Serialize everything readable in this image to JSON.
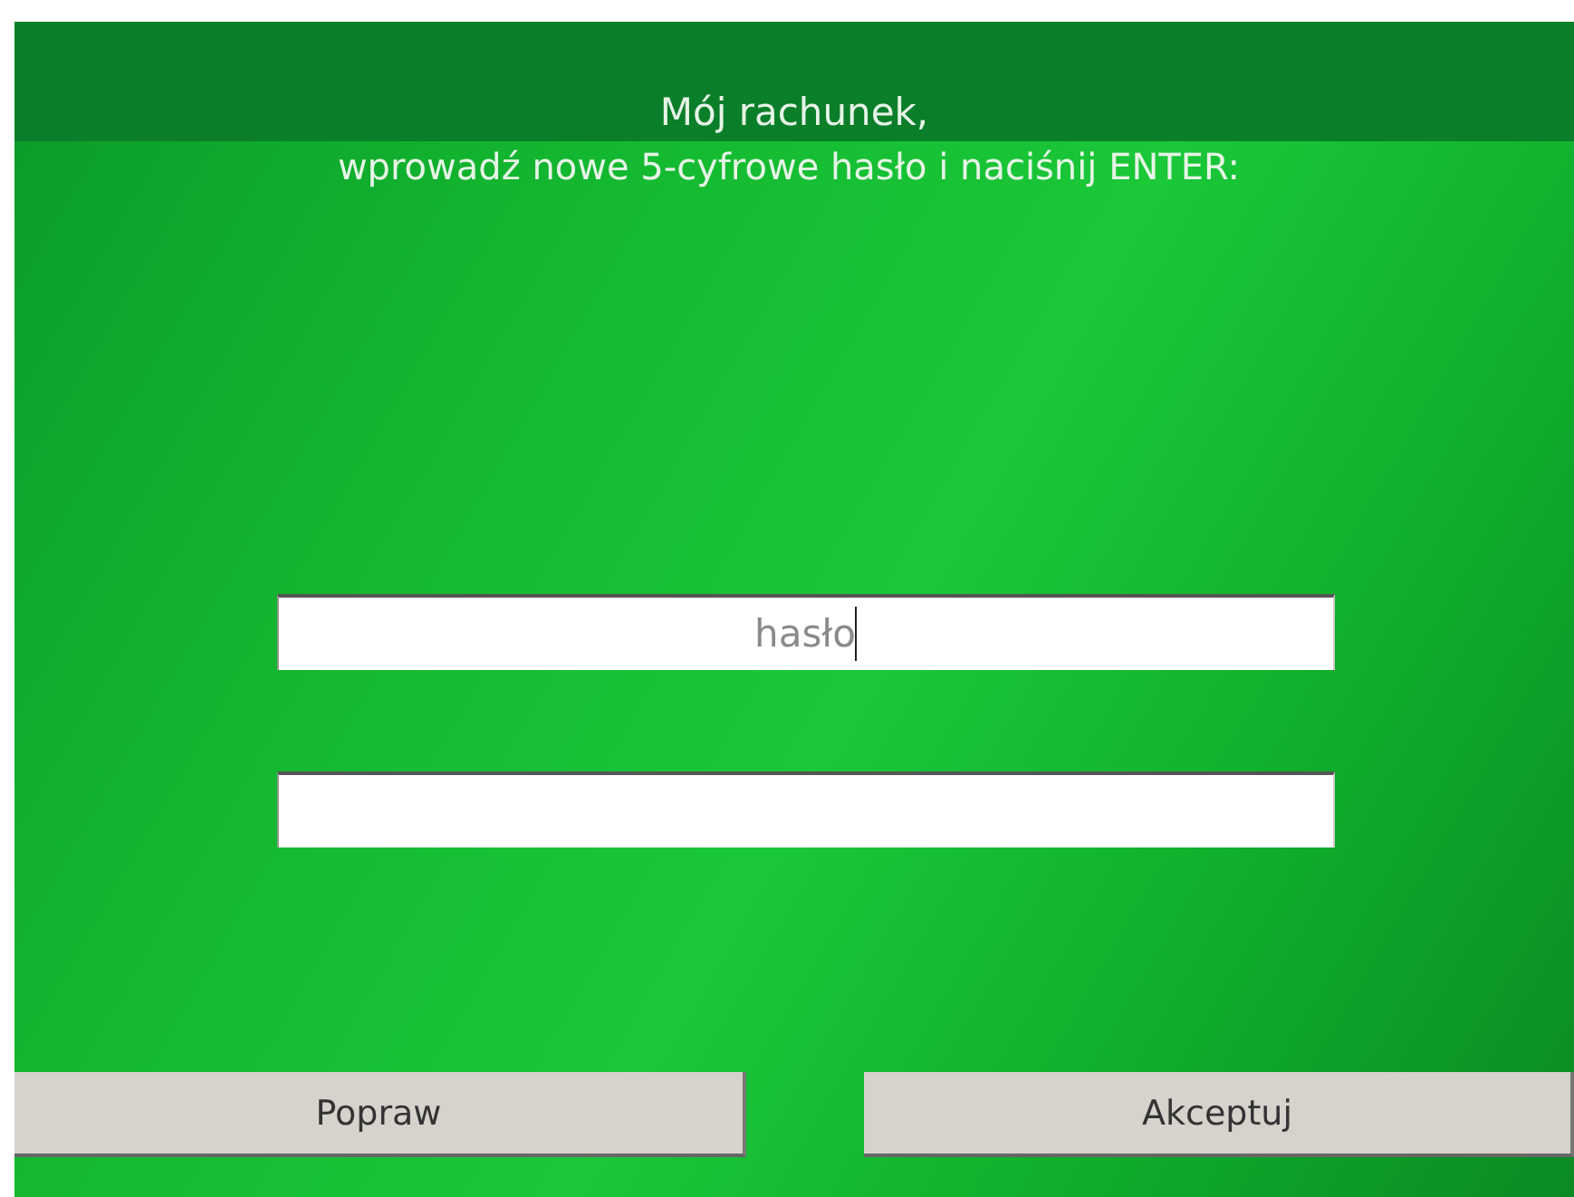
{
  "header": {
    "title": "Mój rachunek,",
    "instruction": "wprowadź nowe 5-cyfrowe hasło i naciśnij ENTER:"
  },
  "fields": [
    {
      "placeholder": "hasło",
      "focused": true
    },
    {
      "focused": false
    }
  ],
  "buttons": [
    "Popraw",
    "Akceptuj"
  ]
}
